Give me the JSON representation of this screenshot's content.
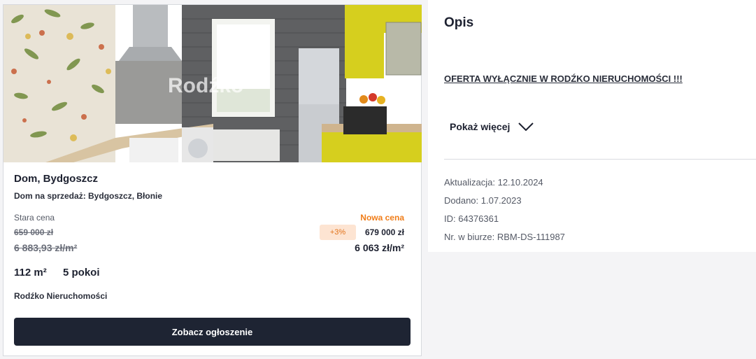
{
  "listing": {
    "image_watermark": "Rodźko",
    "title": "Dom, Bydgoszcz",
    "subtitle": "Dom na sprzedaż: Bydgoszcz, Błonie",
    "old_price_label": "Stara cena",
    "old_price": "659 000 zł",
    "old_price_per_m2": "6 883,93 zł/m²",
    "new_price_label": "Nowa cena",
    "price_change": "+3%",
    "new_price": "679 000 zł",
    "new_price_per_m2": "6 063 zł/m²",
    "area": "112 m²",
    "rooms": "5 pokoi",
    "agency": "Rodźko Nieruchomości",
    "cta_label": "Zobacz ogłoszenie"
  },
  "description": {
    "heading": "Opis",
    "offer_text": "OFERTA WYŁĄCZNIE W RODŹKO NIERUCHOMOŚCI !!!",
    "show_more_label": "Pokaż więcej",
    "show_more_icon": "chevron-down-icon",
    "updated": "Aktualizacja: 12.10.2024",
    "added": "Dodano: 1.07.2023",
    "id": "ID: 64376361",
    "office_number": "Nr. w biurze: RBM-DS-111987"
  },
  "colors": {
    "accent_orange": "#f07d19",
    "badge_bg": "#fde4d2",
    "button_dark": "#1e2433",
    "cabinet_yellow": "#d6cf1e"
  }
}
